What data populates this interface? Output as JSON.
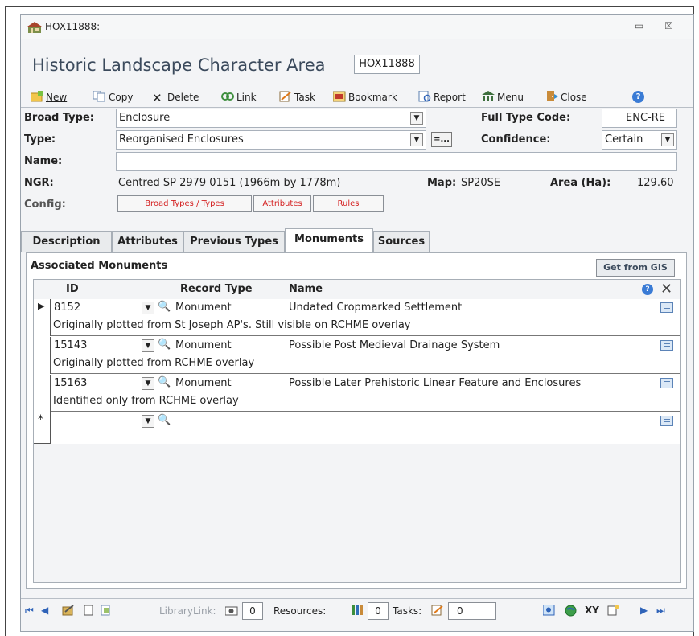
{
  "window": {
    "title": "HOX11888:",
    "minimize_glyph": "▭",
    "close_glyph": "☒"
  },
  "header": {
    "form_title": "Historic Landscape Character Area",
    "record_id": "HOX11888"
  },
  "toolbar": {
    "new": "New",
    "copy": "Copy",
    "delete": "Delete",
    "link": "Link",
    "task": "Task",
    "bookmark": "Bookmark",
    "report": "Report",
    "menu": "Menu",
    "close": "Close"
  },
  "fields": {
    "broad_type_label": "Broad Type:",
    "broad_type_value": "Enclosure",
    "full_type_code_label": "Full Type Code:",
    "full_type_code_value": "ENC-RE",
    "type_label": "Type:",
    "type_value": "Reorganised Enclosures",
    "type_lookup_btn": "=...",
    "confidence_label": "Confidence:",
    "confidence_value": "Certain",
    "name_label": "Name:",
    "name_value": "",
    "ngr_label": "NGR:",
    "ngr_value": "Centred SP 2979 0151 (1966m by 1778m)",
    "map_label": "Map:",
    "map_value": "SP20SE",
    "area_label": "Area (Ha):",
    "area_value": "129.60",
    "config_label": "Config:",
    "config_btn_types": "Broad Types / Types",
    "config_btn_attributes": "Attributes",
    "config_btn_rules": "Rules"
  },
  "tabs": [
    "Description",
    "Attributes",
    "Previous Types",
    "Monuments",
    "Sources"
  ],
  "monuments": {
    "section_title": "Associated Monuments",
    "get_from_gis": "Get from GIS",
    "col_id": "ID",
    "col_record_type": "Record Type",
    "col_name": "Name",
    "help_glyph": "?",
    "delete_glyph": "✕",
    "rows": [
      {
        "id": "8152",
        "record_type": "Monument",
        "name": "Undated Cropmarked Settlement",
        "note": "Originally plotted from St Joseph AP's. Still visible on RCHME overlay"
      },
      {
        "id": "15143",
        "record_type": "Monument",
        "name": "Possible Post Medieval Drainage System",
        "note": "Originally plotted from RCHME overlay"
      },
      {
        "id": "15163",
        "record_type": "Monument",
        "name": "Possible Later Prehistoric Linear Feature and Enclosures",
        "note": "Identified only from RCHME overlay"
      }
    ],
    "new_row_marker": "*",
    "current_row_marker": "▶"
  },
  "statusbar": {
    "library_link_label": "LibraryLink:",
    "library_link_count": "0",
    "resources_label": "Resources:",
    "resources_count": "0",
    "tasks_label": "Tasks:",
    "tasks_count": "0",
    "xy_label": "XY"
  },
  "colors": {
    "config_text": "#d42020",
    "window_border": "#9aa3ad",
    "nav_blue": "#2f63b8"
  }
}
